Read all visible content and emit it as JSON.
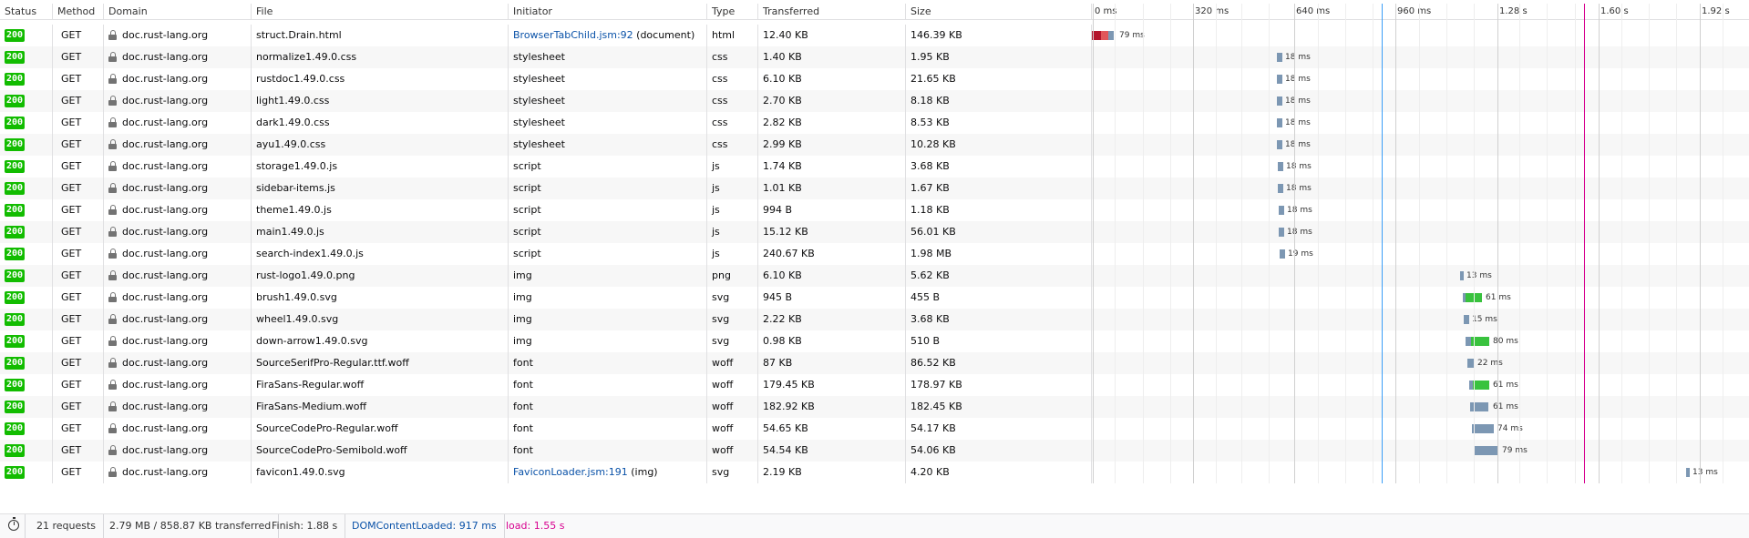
{
  "columns": {
    "status": "Status",
    "method": "Method",
    "domain": "Domain",
    "file": "File",
    "initiator": "Initiator",
    "type": "Type",
    "transferred": "Transferred",
    "size": "Size"
  },
  "timeline_ticks": [
    "0 ms",
    "320 ms",
    "640 ms",
    "960 ms",
    "1.28 s",
    "1.60 s",
    "1.92 s"
  ],
  "requests": [
    {
      "status": "200",
      "method": "GET",
      "domain": "doc.rust-lang.org",
      "file": "struct.Drain.html",
      "initiator_link": "BrowserTabChild.jsm:92",
      "initiator_suffix": "(document)",
      "type": "html",
      "transferred": "12.40 KB",
      "size": "146.39 KB",
      "timing": "79 ms"
    },
    {
      "status": "200",
      "method": "GET",
      "domain": "doc.rust-lang.org",
      "file": "normalize1.49.0.css",
      "initiator": "stylesheet",
      "type": "css",
      "transferred": "1.40 KB",
      "size": "1.95 KB",
      "timing": "18 ms"
    },
    {
      "status": "200",
      "method": "GET",
      "domain": "doc.rust-lang.org",
      "file": "rustdoc1.49.0.css",
      "initiator": "stylesheet",
      "type": "css",
      "transferred": "6.10 KB",
      "size": "21.65 KB",
      "timing": "18 ms"
    },
    {
      "status": "200",
      "method": "GET",
      "domain": "doc.rust-lang.org",
      "file": "light1.49.0.css",
      "initiator": "stylesheet",
      "type": "css",
      "transferred": "2.70 KB",
      "size": "8.18 KB",
      "timing": "18 ms"
    },
    {
      "status": "200",
      "method": "GET",
      "domain": "doc.rust-lang.org",
      "file": "dark1.49.0.css",
      "initiator": "stylesheet",
      "type": "css",
      "transferred": "2.82 KB",
      "size": "8.53 KB",
      "timing": "18 ms"
    },
    {
      "status": "200",
      "method": "GET",
      "domain": "doc.rust-lang.org",
      "file": "ayu1.49.0.css",
      "initiator": "stylesheet",
      "type": "css",
      "transferred": "2.99 KB",
      "size": "10.28 KB",
      "timing": "18 ms"
    },
    {
      "status": "200",
      "method": "GET",
      "domain": "doc.rust-lang.org",
      "file": "storage1.49.0.js",
      "initiator": "script",
      "type": "js",
      "transferred": "1.74 KB",
      "size": "3.68 KB",
      "timing": "18 ms"
    },
    {
      "status": "200",
      "method": "GET",
      "domain": "doc.rust-lang.org",
      "file": "sidebar-items.js",
      "initiator": "script",
      "type": "js",
      "transferred": "1.01 KB",
      "size": "1.67 KB",
      "timing": "18 ms"
    },
    {
      "status": "200",
      "method": "GET",
      "domain": "doc.rust-lang.org",
      "file": "theme1.49.0.js",
      "initiator": "script",
      "type": "js",
      "transferred": "994 B",
      "size": "1.18 KB",
      "timing": "18 ms"
    },
    {
      "status": "200",
      "method": "GET",
      "domain": "doc.rust-lang.org",
      "file": "main1.49.0.js",
      "initiator": "script",
      "type": "js",
      "transferred": "15.12 KB",
      "size": "56.01 KB",
      "timing": "18 ms"
    },
    {
      "status": "200",
      "method": "GET",
      "domain": "doc.rust-lang.org",
      "file": "search-index1.49.0.js",
      "initiator": "script",
      "type": "js",
      "transferred": "240.67 KB",
      "size": "1.98 MB",
      "timing": "19 ms"
    },
    {
      "status": "200",
      "method": "GET",
      "domain": "doc.rust-lang.org",
      "file": "rust-logo1.49.0.png",
      "initiator": "img",
      "type": "png",
      "transferred": "6.10 KB",
      "size": "5.62 KB",
      "timing": "13 ms"
    },
    {
      "status": "200",
      "method": "GET",
      "domain": "doc.rust-lang.org",
      "file": "brush1.49.0.svg",
      "initiator": "img",
      "type": "svg",
      "transferred": "945 B",
      "size": "455 B",
      "timing": "61 ms"
    },
    {
      "status": "200",
      "method": "GET",
      "domain": "doc.rust-lang.org",
      "file": "wheel1.49.0.svg",
      "initiator": "img",
      "type": "svg",
      "transferred": "2.22 KB",
      "size": "3.68 KB",
      "timing": "15 ms"
    },
    {
      "status": "200",
      "method": "GET",
      "domain": "doc.rust-lang.org",
      "file": "down-arrow1.49.0.svg",
      "initiator": "img",
      "type": "svg",
      "transferred": "0.98 KB",
      "size": "510 B",
      "timing": "80 ms"
    },
    {
      "status": "200",
      "method": "GET",
      "domain": "doc.rust-lang.org",
      "file": "SourceSerifPro-Regular.ttf.woff",
      "initiator": "font",
      "type": "woff",
      "transferred": "87 KB",
      "size": "86.52 KB",
      "timing": "22 ms"
    },
    {
      "status": "200",
      "method": "GET",
      "domain": "doc.rust-lang.org",
      "file": "FiraSans-Regular.woff",
      "initiator": "font",
      "type": "woff",
      "transferred": "179.45 KB",
      "size": "178.97 KB",
      "timing": "61 ms"
    },
    {
      "status": "200",
      "method": "GET",
      "domain": "doc.rust-lang.org",
      "file": "FiraSans-Medium.woff",
      "initiator": "font",
      "type": "woff",
      "transferred": "182.92 KB",
      "size": "182.45 KB",
      "timing": "61 ms"
    },
    {
      "status": "200",
      "method": "GET",
      "domain": "doc.rust-lang.org",
      "file": "SourceCodePro-Regular.woff",
      "initiator": "font",
      "type": "woff",
      "transferred": "54.65 KB",
      "size": "54.17 KB",
      "timing": "74 ms"
    },
    {
      "status": "200",
      "method": "GET",
      "domain": "doc.rust-lang.org",
      "file": "SourceCodePro-Semibold.woff",
      "initiator": "font",
      "type": "woff",
      "transferred": "54.54 KB",
      "size": "54.06 KB",
      "timing": "79 ms"
    },
    {
      "status": "200",
      "method": "GET",
      "domain": "doc.rust-lang.org",
      "file": "favicon1.49.0.svg",
      "initiator_link": "FaviconLoader.jsm:191",
      "initiator_suffix": "(img)",
      "type": "svg",
      "transferred": "2.19 KB",
      "size": "4.20 KB",
      "timing": "13 ms"
    }
  ],
  "footer": {
    "requests": "21 requests",
    "transferred": "2.79 MB / 858.87 KB transferred",
    "finish": "Finish: 1.88 s",
    "dom_content_loaded": "DOMContentLoaded: 917 ms",
    "load": "load: 1.55 s"
  },
  "colors": {
    "status_ok": "#12bc00",
    "link": "#0a52a8",
    "dcl_line": "#3a9df7",
    "load_line": "#d7008f",
    "bar_receive": "#7c97b3",
    "bar_green": "#39c23e"
  },
  "icons": {
    "domain": "lock-icon",
    "footer": "stopwatch-icon"
  }
}
